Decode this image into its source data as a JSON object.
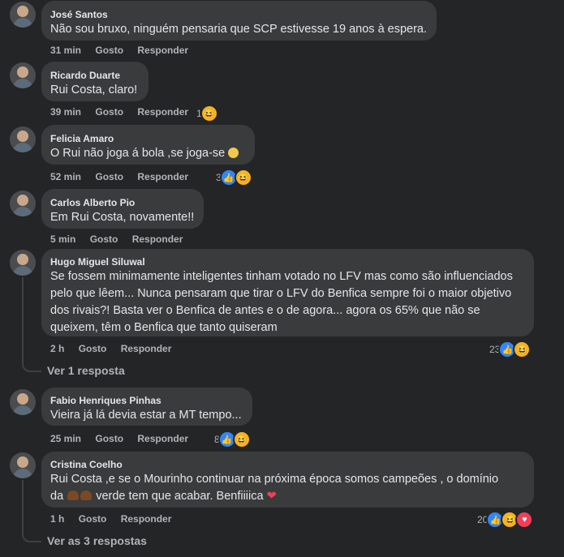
{
  "comments": [
    {
      "author": "José Santos",
      "text": "Não sou bruxo, ninguém pensaria que SCP estivesse 19 anos à espera.",
      "time": "31 min",
      "like": "Gosto",
      "reply": "Responder"
    },
    {
      "author": "Ricardo Duarte",
      "text": "Rui Costa, claro!",
      "time": "39 min",
      "like": "Gosto",
      "reply": "Responder",
      "reaction_count": "1"
    },
    {
      "author": "Felicia Amaro",
      "text": "O Rui não joga á bola ,se joga-se",
      "time": "52 min",
      "like": "Gosto",
      "reply": "Responder",
      "reaction_count": "3"
    },
    {
      "author": "Carlos Alberto Pio",
      "text": "Em Rui Costa, novamente!!",
      "time": "5 min",
      "like": "Gosto",
      "reply": "Responder"
    },
    {
      "author": "Hugo Miguel Siluwal",
      "text": "Se fossem minimamente inteligentes tinham votado no LFV mas como são influenciados pelo que lêem... Nunca pensaram que tirar o LFV do Benfica sempre foi o maior objetivo dos rivais?! Basta ver o Benfica de antes e o de agora... agora os 65% que não se queixem, têm o Benfica que tanto quiseram",
      "time": "2 h",
      "like": "Gosto",
      "reply": "Responder",
      "reaction_count": "23",
      "view_replies": "Ver 1 resposta"
    },
    {
      "author": "Fabio Henriques Pinhas",
      "text": "Vieira já lá devia estar a MT tempo...",
      "time": "25 min",
      "like": "Gosto",
      "reply": "Responder",
      "reaction_count": "8"
    },
    {
      "author": "Cristina Coelho",
      "text_line1": "Rui Costa ,e se o Mourinho continuar na próxima época somos campeões , o domínio",
      "text_line2_a": "da",
      "text_line2_b": "verde tem que acabar. Benfiiiica",
      "time": "1 h",
      "like": "Gosto",
      "reply": "Responder",
      "reaction_count": "20",
      "view_replies": "Ver as 3 respostas"
    }
  ]
}
